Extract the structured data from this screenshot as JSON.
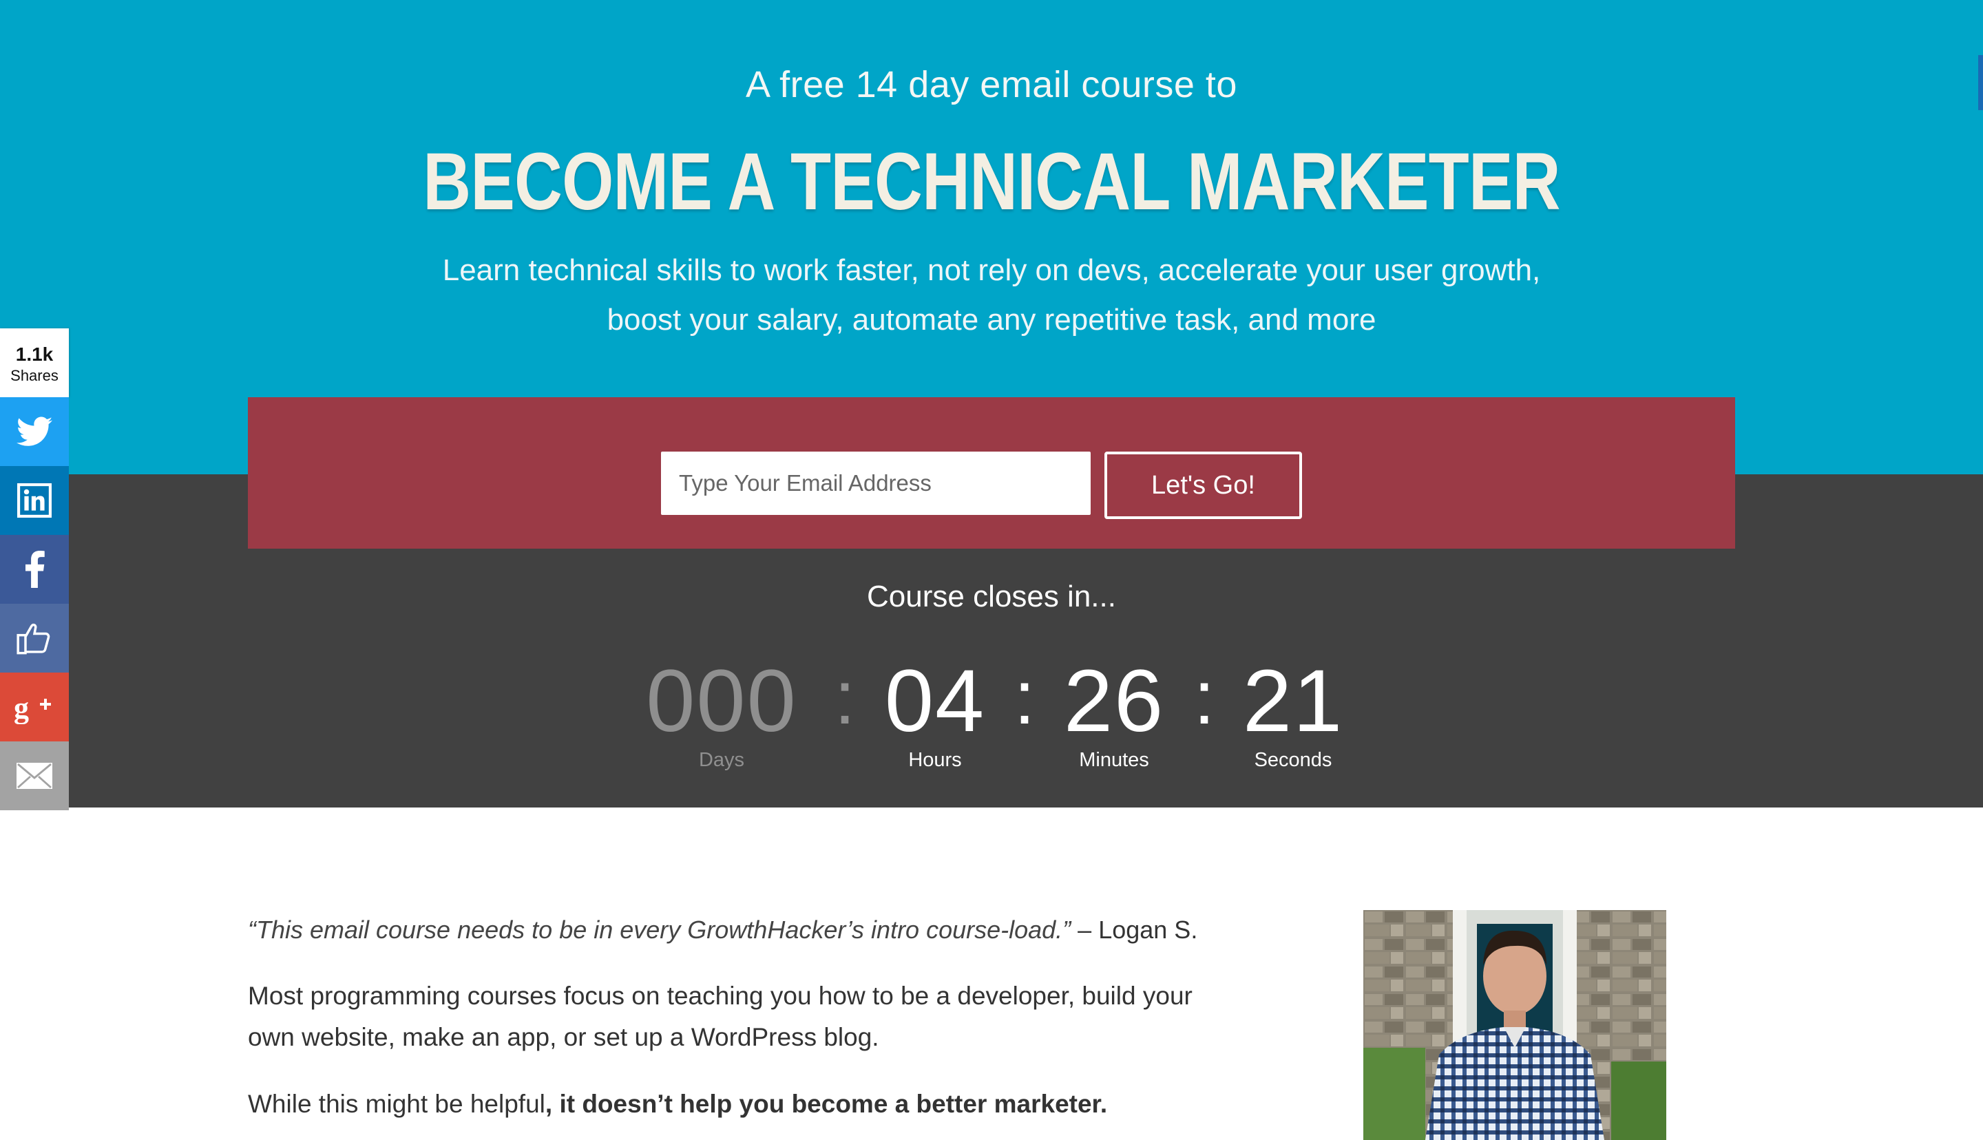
{
  "hero": {
    "subtitle": "A free 14 day email course to",
    "title": "BECOME A TECHNICAL MARKETER",
    "description_line1": "Learn technical skills to work faster, not rely on devs, accelerate your user growth,",
    "description_line2": "boost your salary, automate any repetitive task, and more"
  },
  "signup": {
    "email_placeholder": "Type Your Email Address",
    "email_value": "",
    "submit_label": "Let's Go!"
  },
  "countdown": {
    "heading": "Course closes in...",
    "days": "000",
    "hours": "04",
    "minutes": "26",
    "seconds": "21",
    "separator": ":",
    "days_label": "Days",
    "hours_label": "Hours",
    "minutes_label": "Minutes",
    "seconds_label": "Seconds"
  },
  "share": {
    "count": "1.1k",
    "count_label": "Shares",
    "buttons": [
      {
        "network": "twitter",
        "icon": "twitter-icon",
        "color": "#1da1f2"
      },
      {
        "network": "linkedin",
        "icon": "linkedin-icon",
        "color": "#0077b5"
      },
      {
        "network": "facebook",
        "icon": "facebook-icon",
        "color": "#3b5998"
      },
      {
        "network": "facebook-like",
        "icon": "thumbs-up-icon",
        "color": "#4e6aa1"
      },
      {
        "network": "google-plus",
        "icon": "google-plus-icon",
        "color": "#dc4a38"
      },
      {
        "network": "email",
        "icon": "envelope-icon",
        "color": "#a3a3a3"
      }
    ]
  },
  "content": {
    "quote_text": "“This email course needs to be in every GrowthHacker’s intro course-load.”",
    "quote_author": " – Logan S.",
    "para1": "Most programming courses focus on teaching you how to be a developer, build your own website, make an app, or set up a WordPress blog.",
    "para2_normal": "While this might be helpful",
    "para2_bold": ", it doesn’t help you become a better marketer."
  },
  "colors": {
    "hero_bg": "#00a5c8",
    "form_bg": "#9b3a46",
    "dark_bg": "#414141",
    "title": "#f3efe3"
  }
}
